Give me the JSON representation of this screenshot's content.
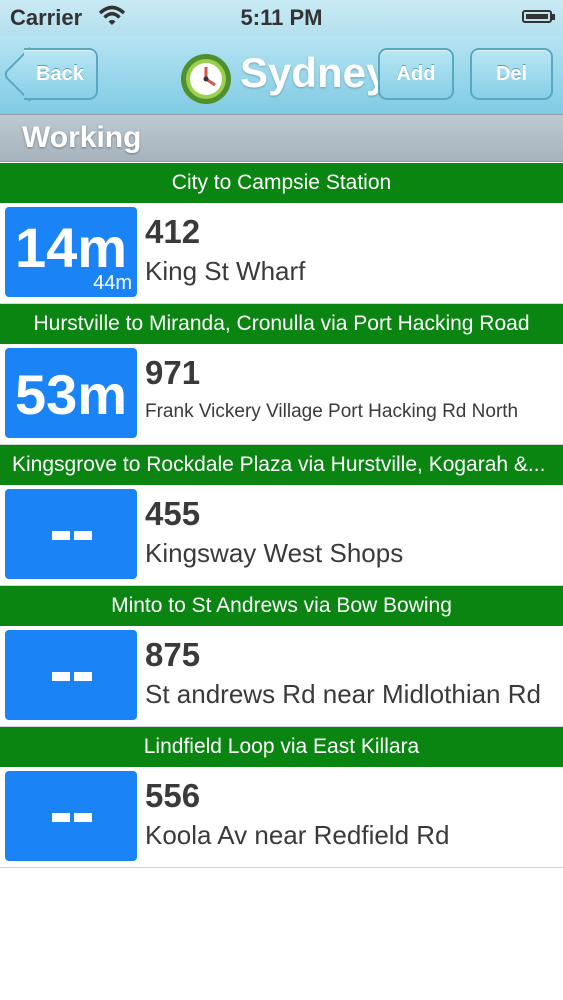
{
  "status_bar": {
    "carrier": "Carrier",
    "time": "5:11 PM"
  },
  "nav": {
    "back_label": "Back",
    "title": "Sydney",
    "add_label": "Add",
    "del_label": "Del"
  },
  "section": {
    "title": "Working"
  },
  "colors": {
    "route_bar": "#0a8512",
    "time_box": "#1a84f7",
    "nav_bar": "#8fd2e8"
  },
  "routes": [
    {
      "description": "City to Campsie Station",
      "time": "14m",
      "next_time": "44m",
      "number": "412",
      "stop": "King St Wharf"
    },
    {
      "description": "Hurstville to Miranda, Cronulla via Port Hacking Road",
      "time": "53m",
      "next_time": "",
      "number": "971",
      "stop": "Frank Vickery Village Port Hacking Rd North"
    },
    {
      "description": "Kingsgrove to Rockdale Plaza via Hurstville, Kogarah &...",
      "time": "",
      "next_time": "",
      "number": "455",
      "stop": "Kingsway West Shops"
    },
    {
      "description": "Minto to St Andrews via Bow Bowing",
      "time": "",
      "next_time": "",
      "number": "875",
      "stop": "St andrews Rd near Midlothian Rd"
    },
    {
      "description": "Lindfield Loop via East Killara",
      "time": "",
      "next_time": "",
      "number": "556",
      "stop": "Koola Av near Redfield Rd"
    }
  ]
}
